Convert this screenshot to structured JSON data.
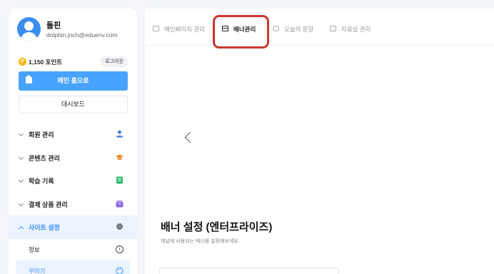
{
  "profile": {
    "name": "돌핀",
    "email": "dolphin.jnch@eduenv.com"
  },
  "points": {
    "coin_symbol": "P",
    "text": "1,150 포인트",
    "logout_label": "로그아웃"
  },
  "buttons": {
    "main_home": "메인 홈으로",
    "dashboard": "대시보드"
  },
  "menu": {
    "items": [
      {
        "label": "회원 관리",
        "icon": "person-icon",
        "color": "#3d7be6"
      },
      {
        "label": "콘텐츠 관리",
        "icon": "graduation-cap-icon",
        "color": "#f08a24"
      },
      {
        "label": "학습 기록",
        "icon": "note-icon",
        "color": "#2fbf71"
      },
      {
        "label": "결제 상품 관리",
        "icon": "box-icon",
        "color": "#8a6ae6"
      },
      {
        "label": "사이트 설정",
        "icon": "gear-icon",
        "color": "#333333"
      }
    ],
    "subitems": [
      {
        "label": "정보",
        "icon": "info-icon"
      },
      {
        "label": "꾸미기",
        "icon": "palette-icon"
      }
    ]
  },
  "tabs": [
    {
      "label": "메인페이지 관리",
      "icon": "layout-icon"
    },
    {
      "label": "배너관리",
      "icon": "banner-icon"
    },
    {
      "label": "오늘의 문장",
      "icon": "chat-icon"
    },
    {
      "label": "자료실 관리",
      "icon": "archive-icon"
    }
  ],
  "section": {
    "title": "배너 설정 (엔터프라이즈)",
    "description": "채널에 사용되는 배너를 설정해보세요."
  },
  "colors": {
    "accent": "#47a3ff",
    "active_text": "#3d8ef2",
    "highlight": "#c8382e"
  }
}
